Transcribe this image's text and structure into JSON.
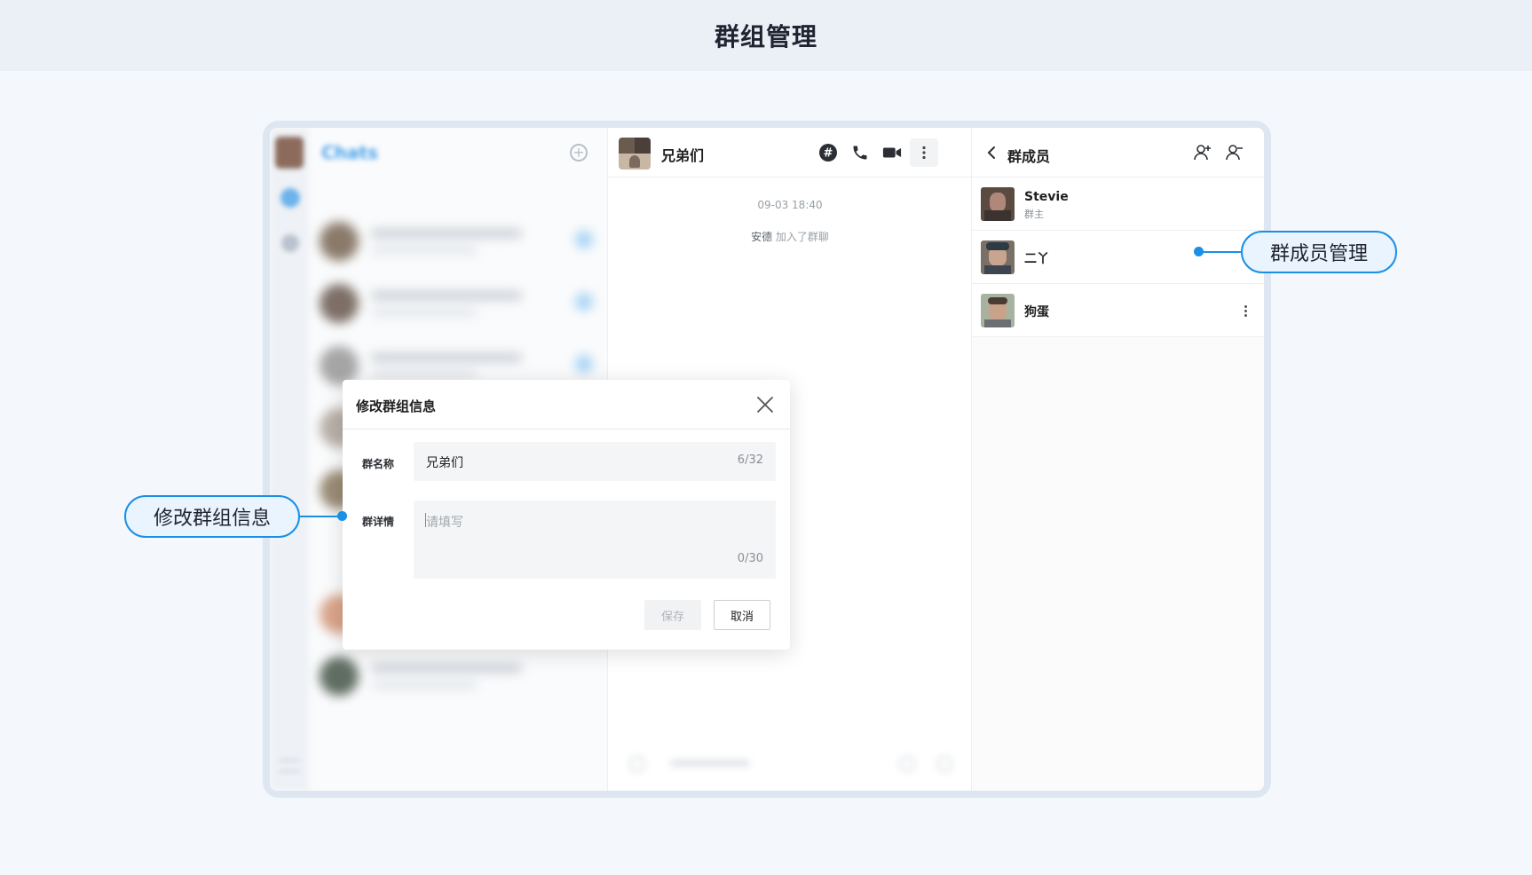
{
  "page": {
    "title": "群组管理"
  },
  "sidebar": {
    "title": "Chats"
  },
  "chat": {
    "name": "兄弟们",
    "time": "09-03 18:40",
    "system_user": "安德",
    "system_text": "加入了群聊"
  },
  "members": {
    "title": "群成员",
    "list": [
      {
        "name": "Stevie",
        "role": "群主"
      },
      {
        "name": "二丫",
        "role": ""
      },
      {
        "name": "狗蛋",
        "role": ""
      }
    ]
  },
  "dialog": {
    "title": "修改群组信息",
    "name_label": "群名称",
    "name_value": "兄弟们",
    "name_count": "6/32",
    "detail_label": "群详情",
    "detail_placeholder": "请填写",
    "detail_count": "0/30",
    "save_label": "保存",
    "cancel_label": "取消"
  },
  "callouts": {
    "left": "修改群组信息",
    "right": "群成员管理"
  },
  "colors": {
    "accent": "#1a8fe6",
    "callout_bg": "#eaf4ff",
    "header_bg": "#ebf0f7"
  }
}
